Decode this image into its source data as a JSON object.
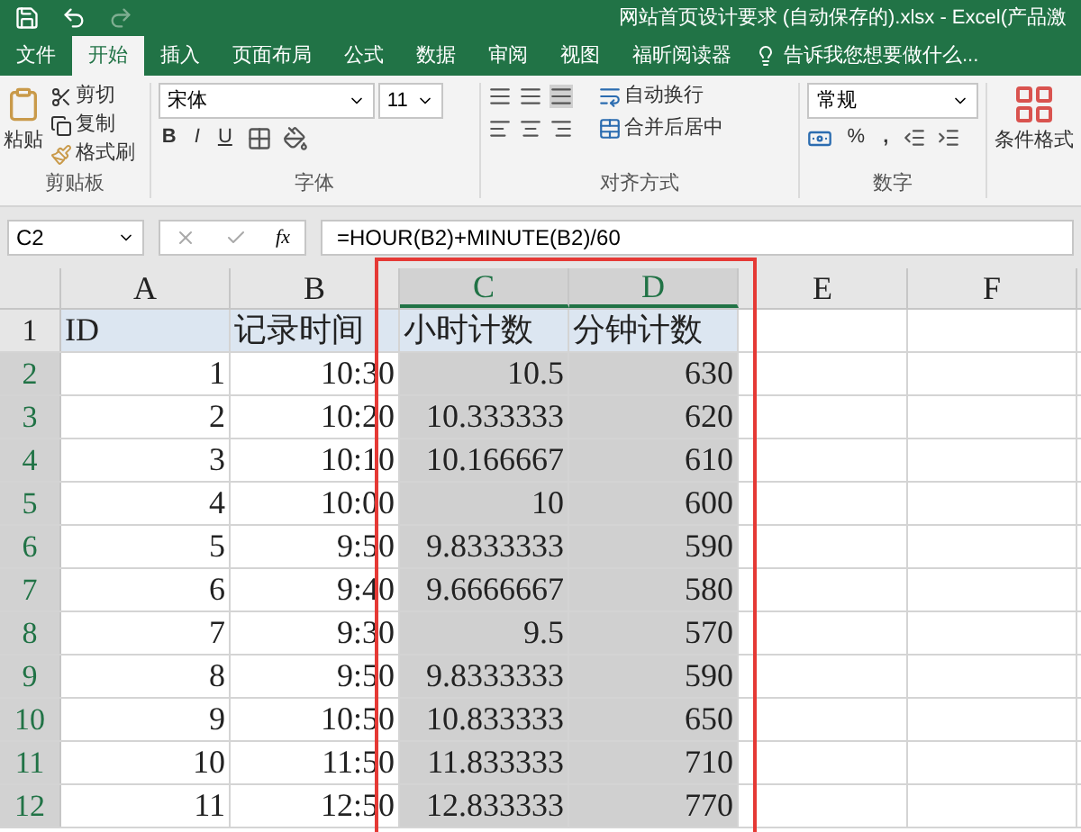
{
  "window": {
    "title": "网站首页设计要求 (自动保存的).xlsx - Excel(产品激"
  },
  "tabs": [
    {
      "label": "文件",
      "selected": false
    },
    {
      "label": "开始",
      "selected": true
    },
    {
      "label": "插入",
      "selected": false
    },
    {
      "label": "页面布局",
      "selected": false
    },
    {
      "label": "公式",
      "selected": false
    },
    {
      "label": "数据",
      "selected": false
    },
    {
      "label": "审阅",
      "selected": false
    },
    {
      "label": "视图",
      "selected": false
    },
    {
      "label": "福昕阅读器",
      "selected": false
    }
  ],
  "tell_me": "告诉我您想要做什么...",
  "ribbon": {
    "clipboard": {
      "paste": "粘贴",
      "cut": "剪切",
      "copy": "复制",
      "format_painter": "格式刷",
      "label": "剪贴板"
    },
    "font": {
      "family": "宋体",
      "size": "11",
      "bold": "B",
      "italic": "I",
      "underline": "U",
      "label": "字体"
    },
    "alignment": {
      "wrap": "自动换行",
      "merge": "合并后居中",
      "label": "对齐方式"
    },
    "number": {
      "format": "常规",
      "percent": "%",
      "comma": ",",
      "label": "数字"
    },
    "styles": {
      "conditional": "条件格式"
    }
  },
  "name_box": "C2",
  "function_label": "fx",
  "formula": "=HOUR(B2)+MINUTE(B2)/60",
  "columns": [
    {
      "label": "A",
      "selected": false
    },
    {
      "label": "B",
      "selected": false
    },
    {
      "label": "C",
      "selected": true
    },
    {
      "label": "D",
      "selected": true
    },
    {
      "label": "E",
      "selected": false
    },
    {
      "label": "F",
      "selected": false
    }
  ],
  "rows": [
    {
      "number": "1",
      "selected": false,
      "kind": "header",
      "cells": [
        "ID",
        "记录时间",
        "小时计数",
        "分钟计数"
      ]
    },
    {
      "number": "2",
      "selected": true,
      "kind": "data",
      "cells": [
        "1",
        "10:30",
        "10.5",
        "630"
      ]
    },
    {
      "number": "3",
      "selected": true,
      "kind": "data",
      "cells": [
        "2",
        "10:20",
        "10.333333",
        "620"
      ]
    },
    {
      "number": "4",
      "selected": true,
      "kind": "data",
      "cells": [
        "3",
        "10:10",
        "10.166667",
        "610"
      ]
    },
    {
      "number": "5",
      "selected": true,
      "kind": "data",
      "cells": [
        "4",
        "10:00",
        "10",
        "600"
      ]
    },
    {
      "number": "6",
      "selected": true,
      "kind": "data",
      "cells": [
        "5",
        "9:50",
        "9.8333333",
        "590"
      ]
    },
    {
      "number": "7",
      "selected": true,
      "kind": "data",
      "cells": [
        "6",
        "9:40",
        "9.6666667",
        "580"
      ]
    },
    {
      "number": "8",
      "selected": true,
      "kind": "data",
      "cells": [
        "7",
        "9:30",
        "9.5",
        "570"
      ]
    },
    {
      "number": "9",
      "selected": true,
      "kind": "data",
      "cells": [
        "8",
        "9:50",
        "9.8333333",
        "590"
      ]
    },
    {
      "number": "10",
      "selected": true,
      "kind": "data",
      "cells": [
        "9",
        "10:50",
        "10.833333",
        "650"
      ]
    },
    {
      "number": "11",
      "selected": true,
      "kind": "data",
      "cells": [
        "10",
        "11:50",
        "11.833333",
        "710"
      ]
    },
    {
      "number": "12",
      "selected": true,
      "kind": "data",
      "cells": [
        "11",
        "12:50",
        "12.833333",
        "770"
      ]
    }
  ]
}
